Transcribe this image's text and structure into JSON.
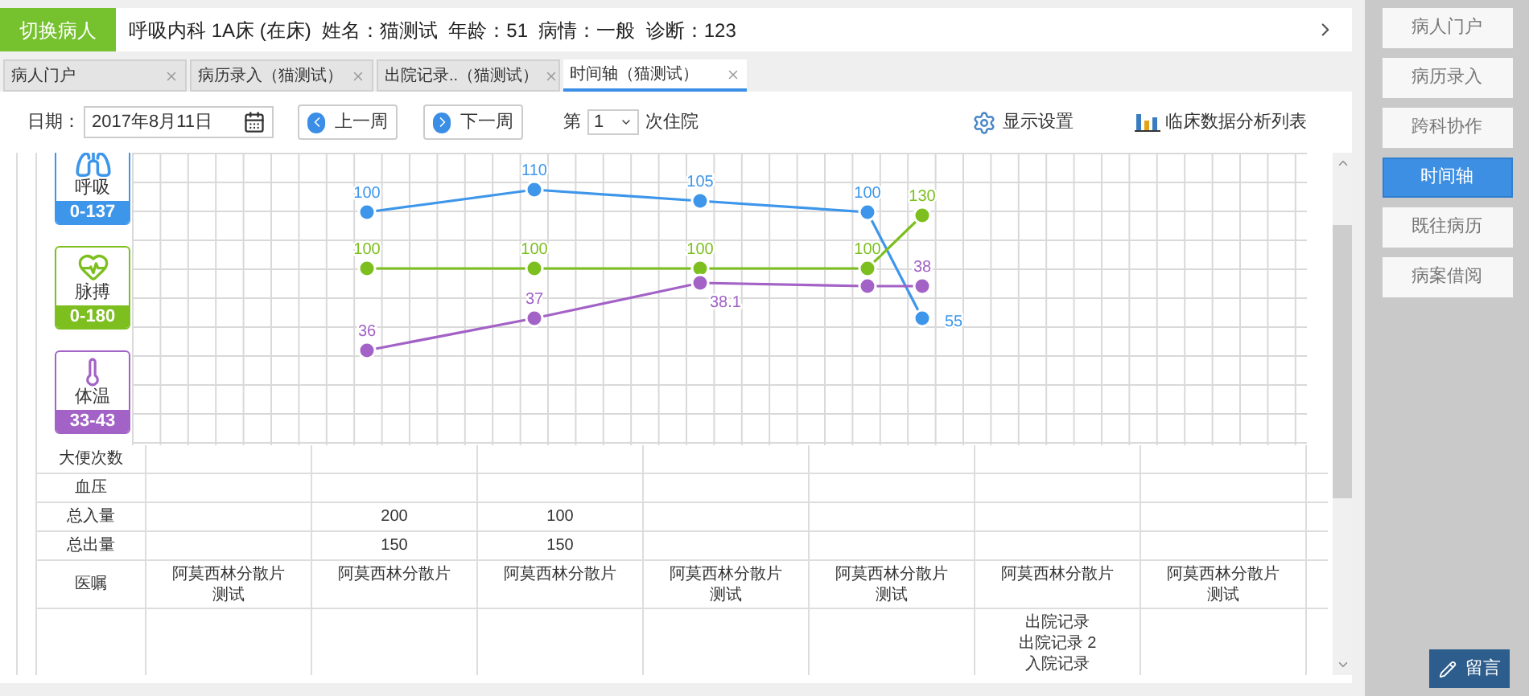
{
  "header": {
    "switch_button": "切换病人",
    "patient_info": "呼吸内科 1A床 (在床)  姓名：猫测试  年龄：51  病情：一般  诊断：123"
  },
  "tabs": [
    {
      "label": "病人门户",
      "selected": false
    },
    {
      "label": "病历录入（猫测试）",
      "selected": false
    },
    {
      "label": "出院记录..（猫测试）",
      "selected": false
    },
    {
      "label": "时间轴（猫测试）",
      "selected": true
    }
  ],
  "toolbar": {
    "date_label": "日期：",
    "date_value": "2017年8月11日",
    "prev_week": "上一周",
    "next_week": "下一周",
    "admission_prefix": "第",
    "admission_value": "1",
    "admission_suffix": "次住院",
    "display_settings": "显示设置",
    "analysis_list": "临床数据分析列表"
  },
  "legend": [
    {
      "kind": "lungs",
      "name": "呼吸",
      "range": "0-137",
      "color": "#3d96ea"
    },
    {
      "kind": "heart",
      "name": "脉搏",
      "range": "0-180",
      "color": "#7cbf1e"
    },
    {
      "kind": "thermometer",
      "name": "体温",
      "range": "33-43",
      "color": "#a262c6"
    }
  ],
  "vitals_chart": {
    "series": [
      {
        "color": "#3d96ea",
        "points": [
          {
            "kind": "labelled",
            "label": "100"
          },
          {
            "kind": "labelled",
            "label": "110"
          },
          {
            "kind": "labelled",
            "label": "105"
          },
          {
            "kind": "labelled",
            "label": "100"
          },
          {
            "kind": "labelled",
            "label": "55"
          }
        ]
      },
      {
        "color": "#7cbf1e",
        "points": [
          {
            "kind": "labelled",
            "label": "100"
          },
          {
            "kind": "labelled",
            "label": "100"
          },
          {
            "kind": "labelled",
            "label": "100"
          },
          {
            "kind": "labelled",
            "label": "100"
          },
          {
            "kind": "labelled",
            "label": "130"
          }
        ]
      },
      {
        "color": "#a262c6",
        "points": [
          {
            "kind": "labelled",
            "label": "36"
          },
          {
            "kind": "labelled",
            "label": "37"
          },
          {
            "kind": "labelled",
            "label": "38.1"
          },
          {
            "kind": "plain"
          },
          {
            "kind": "labelled",
            "label": "38"
          }
        ]
      }
    ]
  },
  "table": {
    "rows": [
      {
        "label": "大便次数",
        "cells": [
          null,
          null,
          null,
          null,
          null,
          null,
          null
        ]
      },
      {
        "label": "血压",
        "cells": [
          null,
          null,
          null,
          null,
          null,
          null,
          null
        ]
      },
      {
        "label": "总入量",
        "cells": [
          null,
          [
            "200"
          ],
          [
            "100"
          ],
          null,
          null,
          null,
          null
        ]
      },
      {
        "label": "总出量",
        "cells": [
          null,
          [
            "150"
          ],
          [
            "150"
          ],
          null,
          null,
          null,
          null
        ]
      },
      {
        "label": "医嘱",
        "cells": [
          [
            "阿莫西林分散片",
            "测试"
          ],
          [
            "阿莫西林分散片"
          ],
          [
            "阿莫西林分散片"
          ],
          [
            "阿莫西林分散片",
            "测试"
          ],
          [
            "阿莫西林分散片",
            "测试"
          ],
          [
            "阿莫西林分散片"
          ],
          [
            "阿莫西林分散片",
            "测试"
          ]
        ]
      },
      {
        "cells": [
          null,
          null,
          null,
          null,
          null,
          [
            "出院记录",
            "出院记录 2",
            "入院记录"
          ],
          null
        ]
      }
    ]
  },
  "side_nav": [
    {
      "label": "病人门户",
      "selected": false
    },
    {
      "label": "病历录入",
      "selected": false
    },
    {
      "label": "跨科协作",
      "selected": false
    },
    {
      "label": "时间轴",
      "selected": true
    },
    {
      "label": "既往病历",
      "selected": false
    },
    {
      "label": "病案借阅",
      "selected": false
    }
  ],
  "message_button": "留言"
}
